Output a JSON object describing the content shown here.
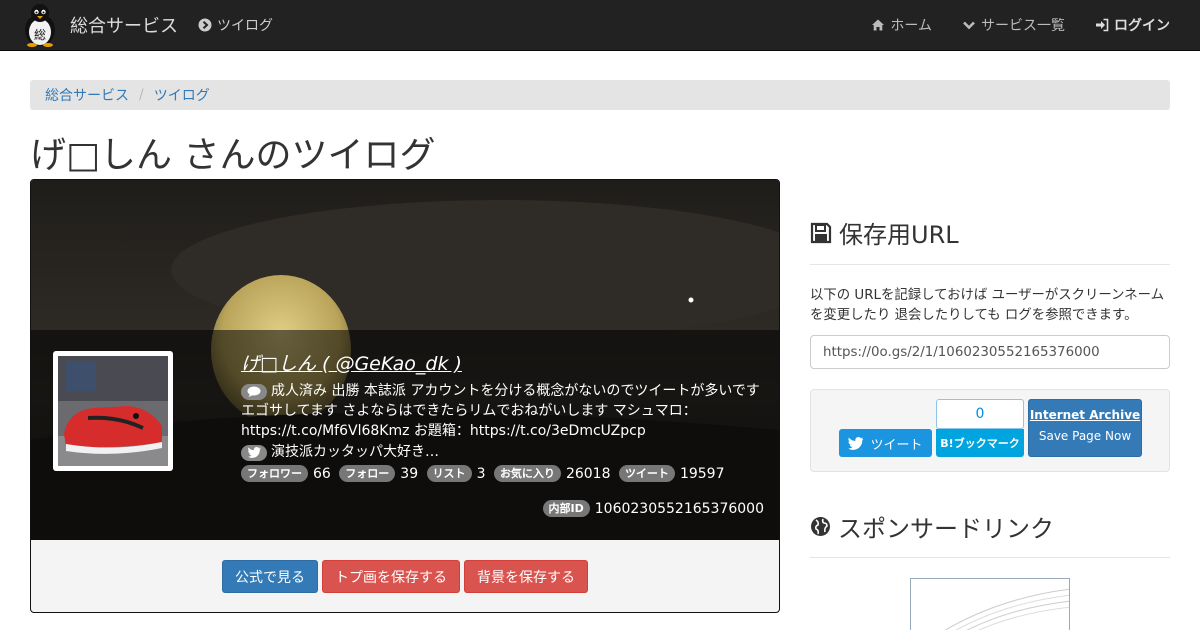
{
  "navbar": {
    "brand": "総合サービス",
    "logo_char": "総",
    "app_link": "ツイログ",
    "items": [
      {
        "label": "ホーム",
        "icon": "home-icon"
      },
      {
        "label": "サービス一覧",
        "icon": "chevron-down-icon"
      },
      {
        "label": "ログイン",
        "icon": "sign-in-icon"
      }
    ]
  },
  "breadcrumb": [
    "総合サービス",
    "ツイログ"
  ],
  "page_title": "げ□しん さんのツイログ",
  "profile": {
    "name": "げ□しん ( @GeKao_dk )",
    "bio_line1": "成人済み 出勝 本誌派 アカウントを分ける概念がないのでツイートが多いです",
    "bio_line2": "エゴサしてます さよならはできたらリムでおねがいします マシュマロ：",
    "bio_line3": "https://t.co/Mf6Vl68Kmz お題箱：https://t.co/3eDmcUZpcp",
    "location": "演技派カッタッパ大好き…",
    "stats": [
      {
        "label": "フォロワー",
        "value": "66"
      },
      {
        "label": "フォロー",
        "value": "39"
      },
      {
        "label": "リスト",
        "value": "3"
      },
      {
        "label": "お気に入り",
        "value": "26018"
      },
      {
        "label": "ツイート",
        "value": "19597"
      }
    ],
    "inner_id_label": "内部ID",
    "inner_id": "1060230552165376000"
  },
  "card_buttons": {
    "official": "公式で見る",
    "save_icon": "トプ画を保存する",
    "save_bg": "背景を保存する"
  },
  "sidebar": {
    "save_url_title": "保存用URL",
    "save_url_desc": "以下の URLを記録しておけば ユーザーがスクリーンネームを変更したり 退会したりしても ログを参照できます。",
    "save_url_value": "https://0o.gs/2/1/1060230552165376000",
    "tweet_label": "ツイート",
    "hatena_count": "0",
    "hatena_label": "B!ブックマーク",
    "ia_title": "Internet Archive",
    "ia_sub": "Save Page Now",
    "sponsor_title": "スポンサードリンク"
  },
  "colors": {
    "navbar": "#222222",
    "link": "#337ab7",
    "primary": "#337ab7",
    "danger": "#d9534f",
    "twitter": "#1b95e0",
    "hatena": "#00a4de"
  }
}
